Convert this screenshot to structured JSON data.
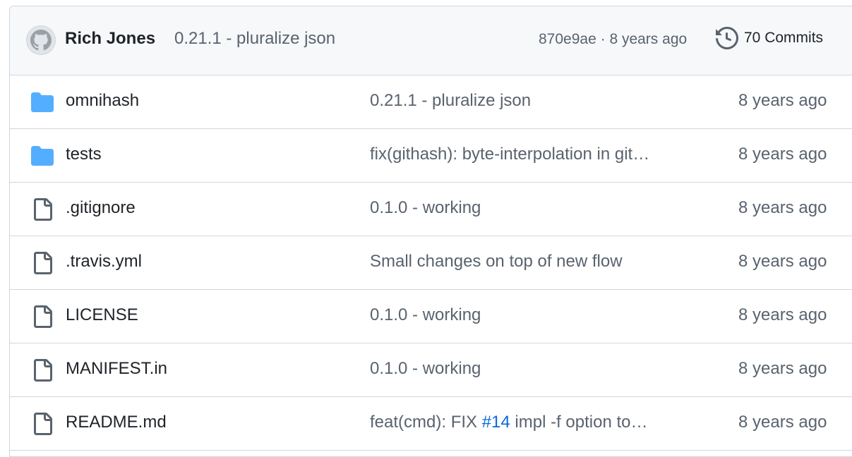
{
  "latest_commit": {
    "author": "Rich Jones",
    "message": "0.21.1 - pluralize json",
    "sha": "870e9ae",
    "separator": " · ",
    "age": "8 years ago",
    "commits_label": "70 Commits"
  },
  "colors": {
    "folder": "#54aeff",
    "file": "#59636e",
    "link": "#0969da"
  },
  "files": [
    {
      "type": "folder",
      "icon": "folder-icon",
      "name": "omnihash",
      "message": "0.21.1 - pluralize json",
      "age": "8 years ago"
    },
    {
      "type": "folder",
      "icon": "folder-icon",
      "name": "tests",
      "message": "fix(githash): byte-interpolation in git…",
      "age": "8 years ago"
    },
    {
      "type": "file",
      "icon": "file-icon",
      "name": ".gitignore",
      "message": "0.1.0 - working",
      "age": "8 years ago"
    },
    {
      "type": "file",
      "icon": "file-icon",
      "name": ".travis.yml",
      "message": "Small changes on top of new flow",
      "age": "8 years ago"
    },
    {
      "type": "file",
      "icon": "file-icon",
      "name": "LICENSE",
      "message": "0.1.0 - working",
      "age": "8 years ago"
    },
    {
      "type": "file",
      "icon": "file-icon",
      "name": "MANIFEST.in",
      "message": "0.1.0 - working",
      "age": "8 years ago"
    },
    {
      "type": "file",
      "icon": "file-icon",
      "name": "README.md",
      "message_prefix": "feat(cmd): FIX ",
      "message_link": "#14",
      "message_suffix": " impl -f option to…",
      "age": "8 years ago"
    }
  ]
}
